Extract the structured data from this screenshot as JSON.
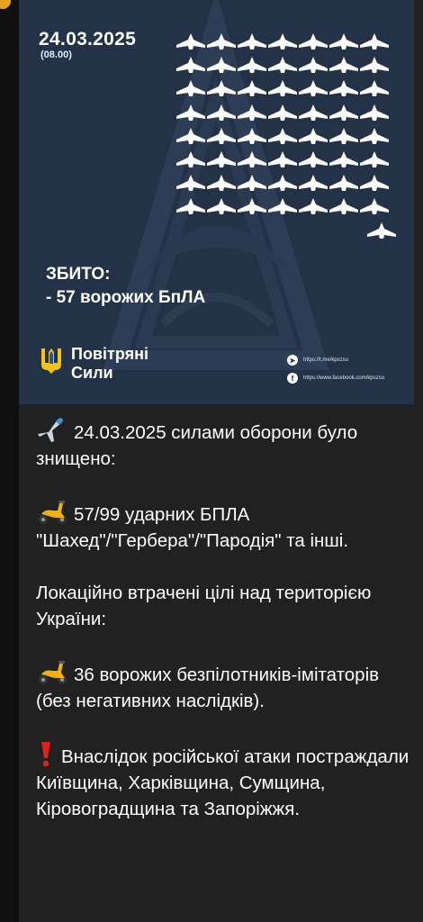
{
  "image": {
    "date": "24.03.2025",
    "time": "(08.00)",
    "drone_rows": [
      7,
      7,
      7,
      7,
      7,
      7,
      7,
      7,
      1
    ],
    "shot_down_label": "ЗБИТО:",
    "shot_down_value": "- 57 ворожих БпЛА",
    "brand_line1": "Повітряні",
    "brand_line2": "Сили",
    "social_telegram": "https://t.me/kpszsu",
    "social_facebook": "https://www.facebook.com/kpszsu",
    "colors": {
      "background": "#233247",
      "drone": "#ffffff",
      "accent": "#e8a020"
    }
  },
  "message": {
    "p1": "24.03.2025 силами оборони було знищено:",
    "p2": "57/99 ударних БПЛА \"Шахед\"/\"Гербера\"/\"Пародія\" та інші.",
    "p3": "Локаційно втрачені цілі над територією України:",
    "p4": "36 ворожих безпілотників-імітаторів (без негативних наслідків).",
    "p5": "Внаслідок російської атаки постраждали Київщина, Харківщина, Сумщина, Кіровоградщина та Запоріжжя.",
    "icons": [
      "airplane-icon",
      "scooter-icon",
      "scooter-icon",
      "exclamation-icon"
    ]
  }
}
